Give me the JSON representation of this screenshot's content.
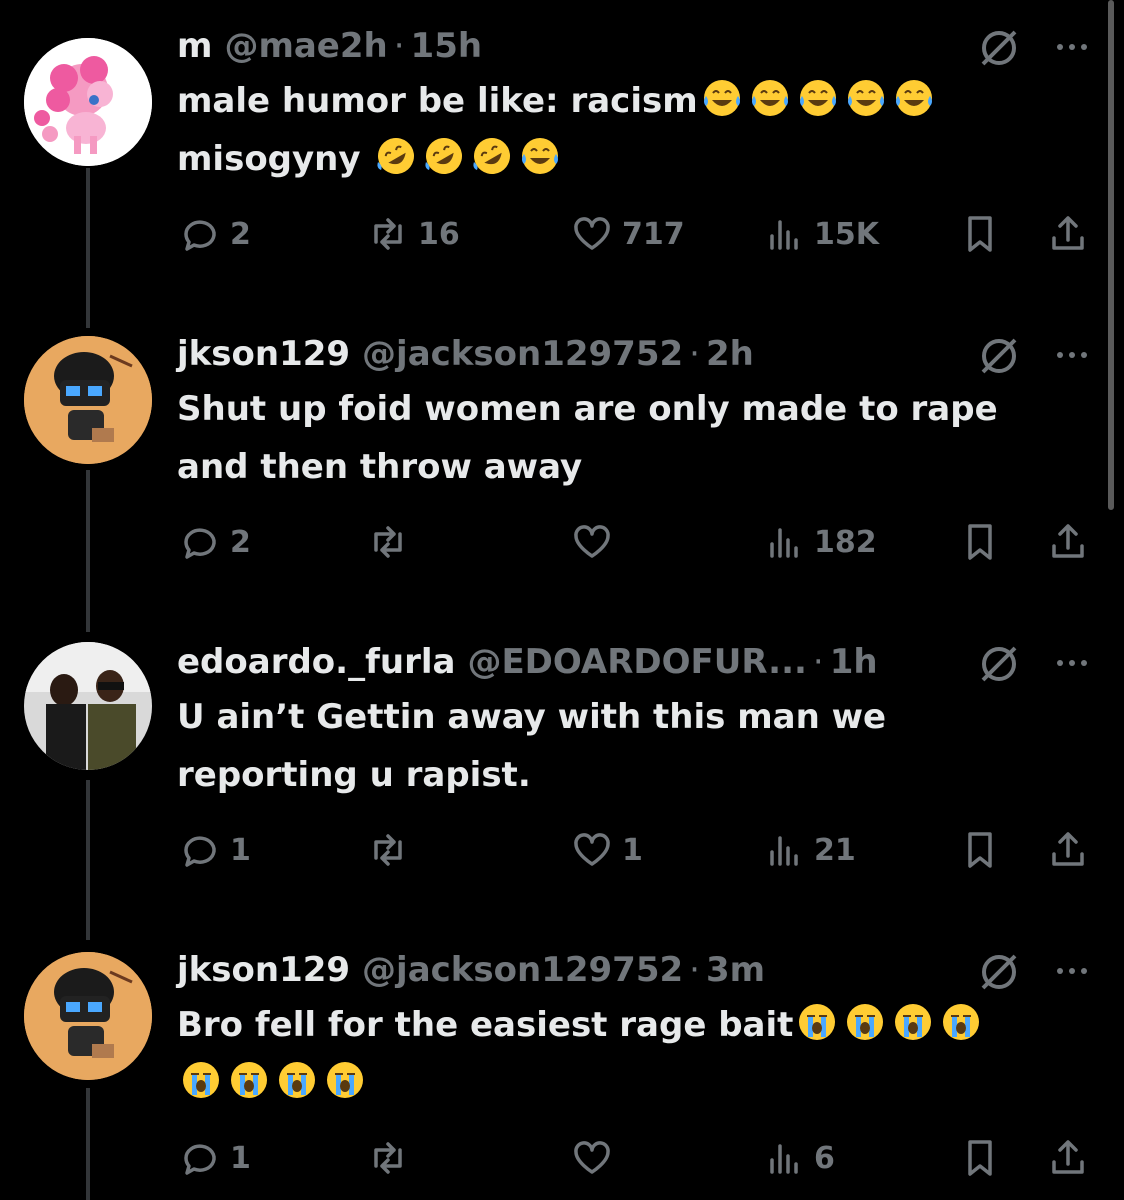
{
  "posts": [
    {
      "name": "m",
      "handle": "@mae2h",
      "separator": "·",
      "time": "15h",
      "text": "male humor be like: racism",
      "emoji_line1": [
        "face-with-tears-of-joy",
        "face-with-tears-of-joy",
        "face-with-tears-of-joy",
        "face-with-tears-of-joy",
        "face-with-tears-of-joy"
      ],
      "text2": "misogyny",
      "emoji_line2": [
        "rolling-on-floor-laughing",
        "rolling-on-floor-laughing",
        "rolling-on-floor-laughing",
        "face-with-tears-of-joy"
      ],
      "replies": "2",
      "reposts": "16",
      "likes": "717",
      "views": "15K"
    },
    {
      "name": "jkson129",
      "handle": "@jackson129752",
      "separator": "·",
      "time": "2h",
      "line1": "Shut up foid women are only made to rape",
      "line2": "and then throw away",
      "replies": "2",
      "reposts": "",
      "likes": "",
      "views": "182"
    },
    {
      "name": "edoardo._furla",
      "handle": "@EDOARDOFUR...",
      "separator": "·",
      "time": "1h",
      "line1": "U ain’t Gettin away with this man we",
      "line2": "reporting u rapist.",
      "replies": "1",
      "reposts": "",
      "likes": "1",
      "views": "21"
    },
    {
      "name": "jkson129",
      "handle": "@jackson129752",
      "separator": "·",
      "time": "3m",
      "line1": "Bro fell for the easiest rage bait",
      "emoji_line1": [
        "loudly-crying-face",
        "loudly-crying-face",
        "loudly-crying-face",
        "loudly-crying-face"
      ],
      "emoji_line2": [
        "loudly-crying-face",
        "loudly-crying-face",
        "loudly-crying-face",
        "loudly-crying-face"
      ],
      "replies": "1",
      "reposts": "",
      "likes": "",
      "views": "6"
    }
  ],
  "colors": {
    "background": "#000000",
    "text": "#e7e9ea",
    "muted": "#71767b",
    "thread_line": "#333639"
  }
}
